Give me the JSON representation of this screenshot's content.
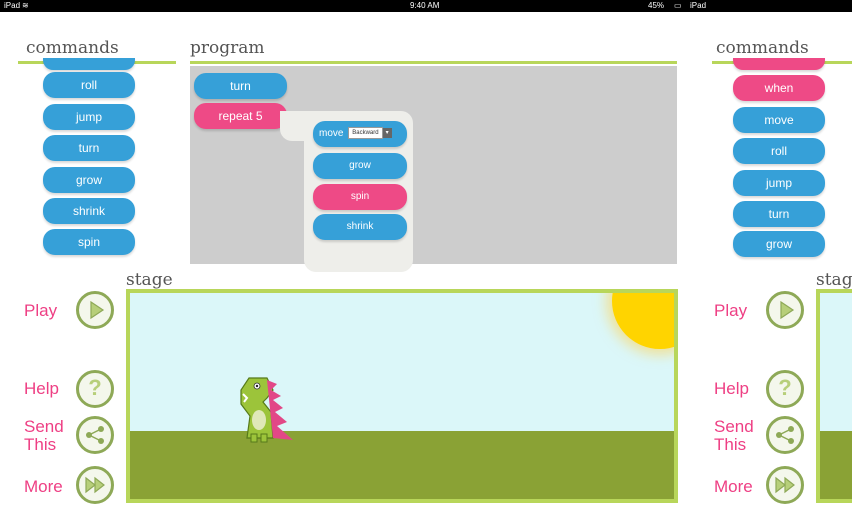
{
  "status_bar": {
    "left": "iPad",
    "time": "9:40 AM",
    "battery": "45%",
    "right": "iPad"
  },
  "left_panel": {
    "title": "commands",
    "commands": [
      "roll",
      "jump",
      "turn",
      "grow",
      "shrink",
      "spin"
    ]
  },
  "program": {
    "title": "program",
    "blocks": [
      {
        "label": "turn",
        "color": "#36a0d8"
      },
      {
        "label": "repeat 5",
        "color": "#ee4a86"
      }
    ],
    "repeat_block": {
      "move_label": "move",
      "move_select": "Backward",
      "items": [
        {
          "label": "grow",
          "color": "#36a0d8"
        },
        {
          "label": "spin",
          "color": "#ee4a86"
        },
        {
          "label": "shrink",
          "color": "#36a0d8"
        }
      ]
    }
  },
  "stage": {
    "title": "stage"
  },
  "side_buttons": {
    "play": "Play",
    "help": "Help",
    "send_line1": "Send",
    "send_line2": "This",
    "more": "More"
  },
  "right_panel": {
    "title": "commands",
    "commands": [
      {
        "label": "when",
        "color": "#ee4a86"
      },
      {
        "label": "move",
        "color": "#36a0d8"
      },
      {
        "label": "roll",
        "color": "#36a0d8"
      },
      {
        "label": "jump",
        "color": "#36a0d8"
      },
      {
        "label": "turn",
        "color": "#36a0d8"
      },
      {
        "label": "grow",
        "color": "#36a0d8"
      }
    ],
    "stage_title": "stage"
  },
  "colors": {
    "command_blue": "#36a0d8",
    "command_pink": "#ee4a86",
    "accent_green": "#b8d65a",
    "ground": "#8aa235",
    "sky": "#dbf7f9",
    "sun": "#ffd400"
  }
}
